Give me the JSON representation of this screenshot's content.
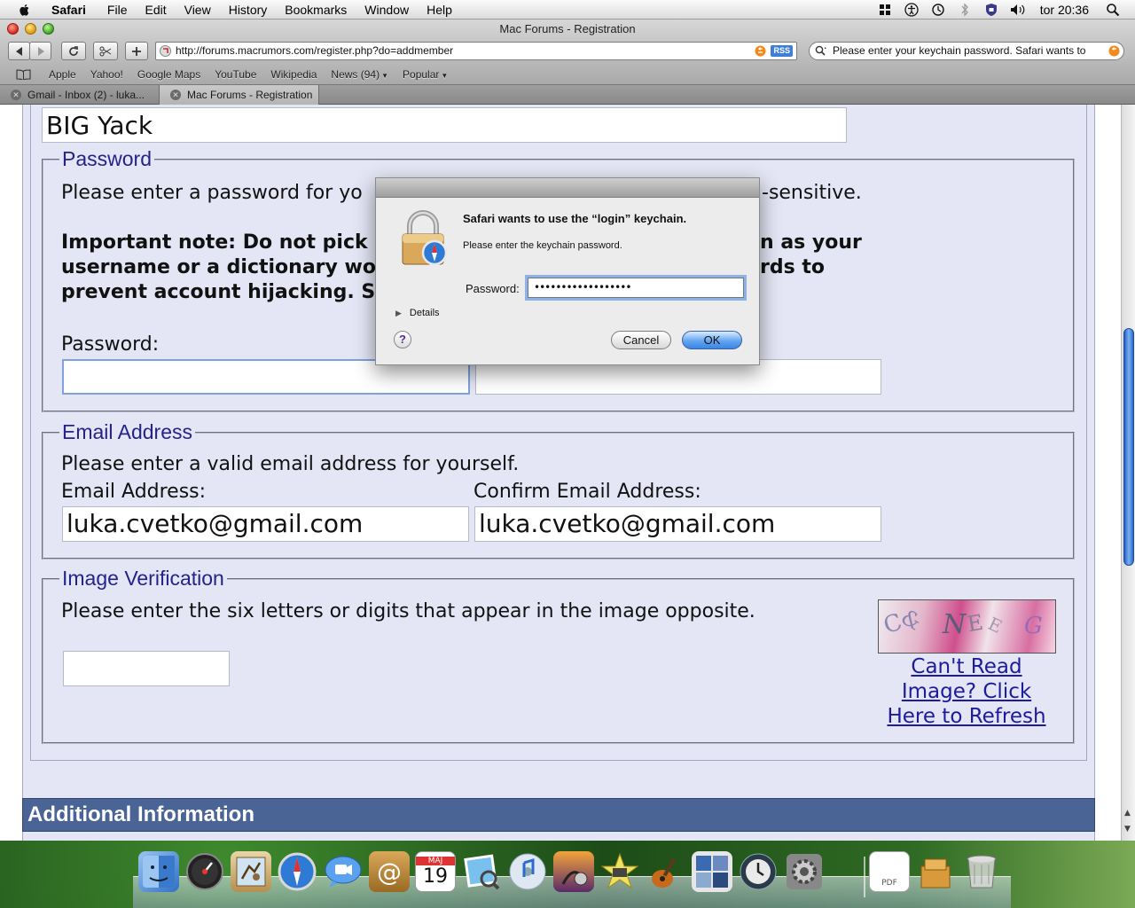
{
  "menubar": {
    "items": [
      "Safari",
      "File",
      "Edit",
      "View",
      "History",
      "Bookmarks",
      "Window",
      "Help"
    ],
    "clock": "tor 20:36"
  },
  "window": {
    "title": "Mac Forums - Registration"
  },
  "toolbar": {
    "url": "http://forums.macrumors.com/register.php?do=addmember",
    "rss": "RSS",
    "search_value": "Please enter your keychain password. Safari wants to"
  },
  "bookmarks": {
    "items": [
      "Apple",
      "Yahoo!",
      "Google Maps",
      "YouTube",
      "Wikipedia"
    ],
    "news": "News (94)",
    "popular": "Popular"
  },
  "tabs": [
    {
      "label": "Gmail - Inbox (2) - luka..."
    },
    {
      "label": "Mac Forums - Registration"
    }
  ],
  "form": {
    "username_value": "BIG Yack",
    "password": {
      "legend": "Password",
      "intro_left": "Please enter a password for yo",
      "intro_right": "-sensitive.",
      "note_line1_left": "Important note: Do not pick",
      "note_line1_right": "n as your",
      "note_line2_left": "username or a dictionary wo",
      "note_line2_right": "rds to",
      "note_line3_left": "prevent account hijacking. S",
      "label": "Password:"
    },
    "email": {
      "legend": "Email Address",
      "intro": "Please enter a valid email address for yourself.",
      "label": "Email Address:",
      "confirm_label": "Confirm Email Address:",
      "value": "luka.cvetko@gmail.com",
      "confirm_value": "luka.cvetko@gmail.com"
    },
    "verification": {
      "legend": "Image Verification",
      "intro": "Please enter the six letters or digits that appear in the image opposite.",
      "refresh_link": "Can't Read Image? Click Here to Refresh"
    },
    "additional_header": "Additional Information"
  },
  "dialog": {
    "heading": "Safari wants to use the “login” keychain.",
    "subtext": "Please enter the keychain password.",
    "password_label": "Password:",
    "password_mask": "••••••••••••••••••",
    "details_label": "Details",
    "help_label": "?",
    "cancel_label": "Cancel",
    "ok_label": "OK"
  },
  "dock": {
    "calendar_month": "MAJ",
    "calendar_day": "19",
    "pdf_label": "PDF"
  },
  "colors": {
    "form_bg": "#e4e6f6",
    "legend_text": "#23238a",
    "link": "#1c1c9c",
    "header_bg": "#4b6496",
    "ok_button": "#3a86e4"
  }
}
